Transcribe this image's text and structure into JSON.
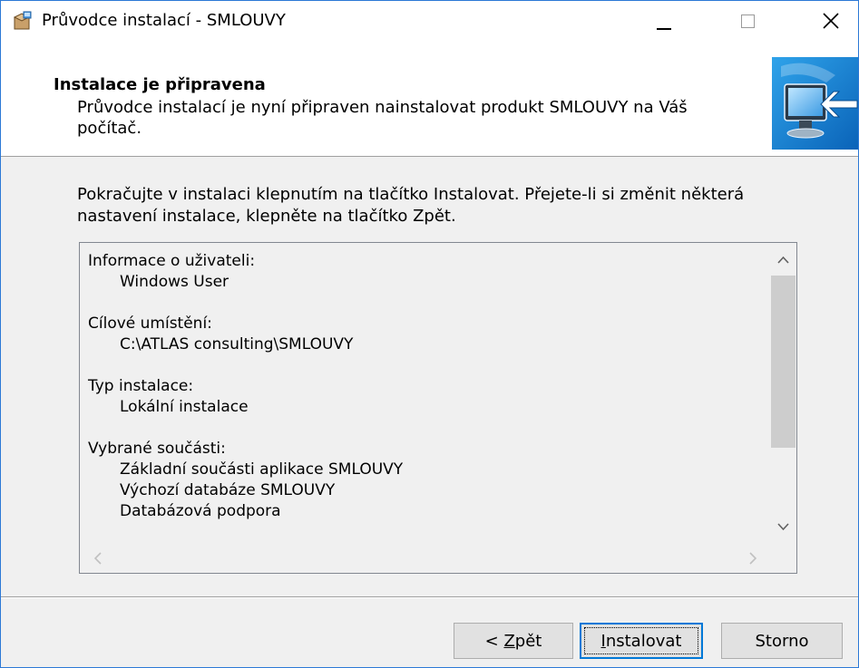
{
  "window": {
    "title": "Průvodce instalací - SMLOUVY"
  },
  "header": {
    "title": "Instalace je připravena",
    "description": "Průvodce instalací je nyní připraven nainstalovat produkt SMLOUVY na Váš počítač."
  },
  "intro": "Pokračujte v instalaci klepnutím na tlačítko Instalovat. Přejete-li si změnit některá nastavení instalace, klepněte na tlačítko Zpět.",
  "summary": {
    "user_heading": "Informace o uživateli:",
    "user_value": "Windows User",
    "dir_heading": "Cílové umístění:",
    "dir_value": "C:\\ATLAS consulting\\SMLOUVY",
    "type_heading": "Typ instalace:",
    "type_value": "Lokální instalace",
    "components_heading": "Vybrané součásti:",
    "components": [
      "Základní součásti aplikace SMLOUVY",
      "Výchozí databáze SMLOUVY",
      "Databázová podpora"
    ]
  },
  "buttons": {
    "back_prefix": "< ",
    "back_accel": "Z",
    "back_rest": "pět",
    "install_accel": "I",
    "install_rest": "nstalovat",
    "cancel": "Storno"
  },
  "colors": {
    "accent": "#0078d7",
    "window_border": "#2b78d6",
    "face": "#f0f0f0"
  },
  "icons": {
    "app": "installer-box-icon",
    "wizard": "computer-monitor-arrow-icon"
  }
}
